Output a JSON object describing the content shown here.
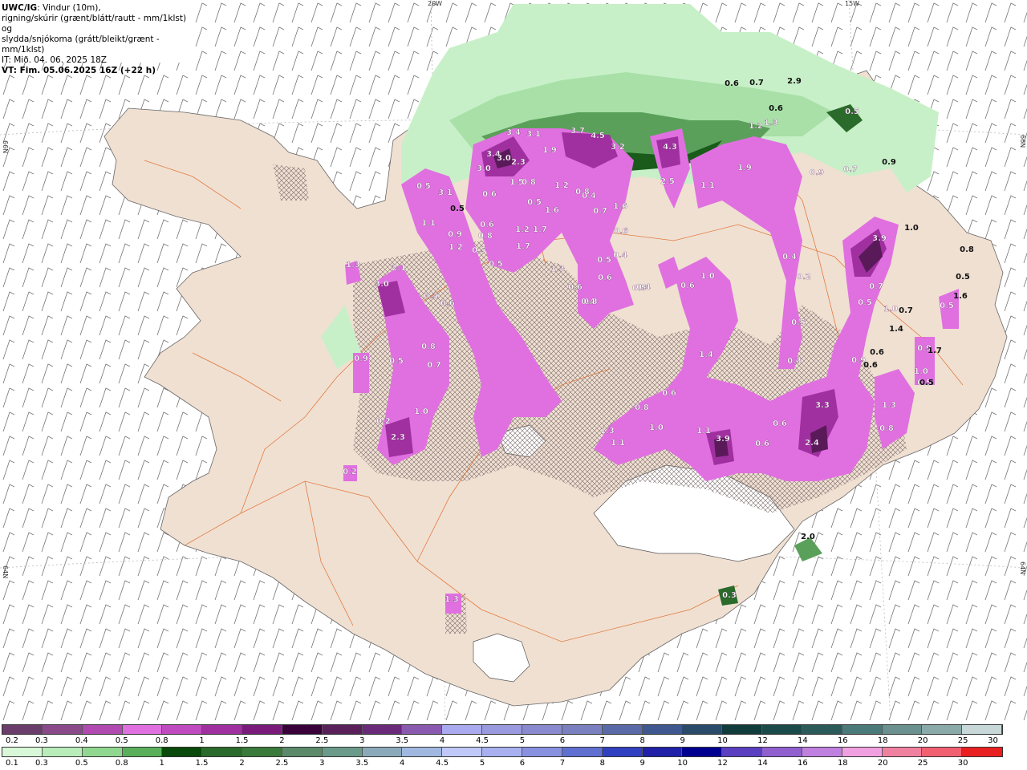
{
  "header": {
    "product": "UWC/IG",
    "line1_rest": ": Vindur (10m),",
    "line2": "rigning/skúrir (grænt/blátt/rautt - mm/1klst) og",
    "line3": "slydda/snjókoma (grátt/bleikt/grænt - mm/1klst)",
    "line4": "IT: Mið. 04. 06. 2025 18Z",
    "line5": "VT: Fim. 05.06.2025 16Z (+22 h)"
  },
  "grid_labels": {
    "lon_20w": "20W",
    "lon_15w": "15W",
    "lat_66n_left": "66N",
    "lat_66n_right": "66N",
    "lat_64n_left": "64N",
    "lat_64n_right": "64N"
  },
  "values": [
    {
      "text": "3.4",
      "c": "light"
    },
    {
      "text": "3.1",
      "c": "light"
    },
    {
      "text": "3.7",
      "c": "light"
    },
    {
      "text": "4.5",
      "c": "light"
    },
    {
      "text": "3.2",
      "c": "light"
    },
    {
      "text": "4.3",
      "c": "light"
    },
    {
      "text": "3.4",
      "c": "light"
    },
    {
      "text": "3.0",
      "c": "light"
    },
    {
      "text": "3.0",
      "c": "light"
    },
    {
      "text": "2.3",
      "c": "light"
    },
    {
      "text": "1.9",
      "c": "light"
    },
    {
      "text": "1.5",
      "c": "light"
    },
    {
      "text": "1.2",
      "c": "light"
    },
    {
      "text": "1.6",
      "c": "light"
    },
    {
      "text": "2.5",
      "c": "light"
    },
    {
      "text": "1.1",
      "c": "light"
    },
    {
      "text": "1.9",
      "c": "light"
    },
    {
      "text": "0.9",
      "c": "light"
    },
    {
      "text": "0.7",
      "c": "light"
    },
    {
      "text": "1.2",
      "c": "light"
    },
    {
      "text": "1.3",
      "c": "light"
    },
    {
      "text": "0.6",
      "c": "dark"
    },
    {
      "text": "0.7",
      "c": "dark"
    },
    {
      "text": "2.9",
      "c": "dark"
    },
    {
      "text": "0.6",
      "c": "dark"
    },
    {
      "text": "0.5",
      "c": "light"
    },
    {
      "text": "0.9",
      "c": "dark"
    },
    {
      "text": "3.9",
      "c": "light"
    },
    {
      "text": "1.0",
      "c": "dark"
    },
    {
      "text": "0.8",
      "c": "dark"
    },
    {
      "text": "0.5",
      "c": "dark"
    },
    {
      "text": "0.7",
      "c": "light"
    },
    {
      "text": "0.5",
      "c": "light"
    },
    {
      "text": "1.0",
      "c": "light"
    },
    {
      "text": "0.7",
      "c": "dark"
    },
    {
      "text": "1.4",
      "c": "dark"
    },
    {
      "text": "0.6",
      "c": "dark"
    },
    {
      "text": "0.9",
      "c": "light"
    },
    {
      "text": "0.6",
      "c": "dark"
    },
    {
      "text": "0.5",
      "c": "light"
    },
    {
      "text": "1.6",
      "c": "dark"
    },
    {
      "text": "0.5",
      "c": "light"
    },
    {
      "text": "0.9",
      "c": "light"
    },
    {
      "text": "1.7",
      "c": "dark"
    },
    {
      "text": "1.0",
      "c": "light"
    },
    {
      "text": "0.5",
      "c": "dark"
    },
    {
      "text": "1.3",
      "c": "light"
    },
    {
      "text": "0.8",
      "c": "light"
    },
    {
      "text": "3.3",
      "c": "light"
    },
    {
      "text": "2.4",
      "c": "light"
    },
    {
      "text": "0.6",
      "c": "light"
    },
    {
      "text": "0.6",
      "c": "light"
    },
    {
      "text": "3.9",
      "c": "light"
    },
    {
      "text": "1.1",
      "c": "light"
    },
    {
      "text": "1.0",
      "c": "light"
    },
    {
      "text": "0.6",
      "c": "light"
    },
    {
      "text": "0.8",
      "c": "light"
    },
    {
      "text": "1.3",
      "c": "light"
    },
    {
      "text": "1.1",
      "c": "light"
    },
    {
      "text": "1.4",
      "c": "light"
    },
    {
      "text": "1.0",
      "c": "light"
    },
    {
      "text": "0.6",
      "c": "light"
    },
    {
      "text": "0.5",
      "c": "light"
    },
    {
      "text": "0.3",
      "c": "light"
    },
    {
      "text": "0.3",
      "c": "light"
    },
    {
      "text": "0.2",
      "c": "light"
    },
    {
      "text": "0.5",
      "c": "light"
    },
    {
      "text": "0.4",
      "c": "light"
    },
    {
      "text": "0.6",
      "c": "light"
    },
    {
      "text": "0.4",
      "c": "light"
    },
    {
      "text": "0.5",
      "c": "light"
    },
    {
      "text": "0.6",
      "c": "light"
    },
    {
      "text": "0.4",
      "c": "light"
    },
    {
      "text": "1.6",
      "c": "light"
    },
    {
      "text": "0.7",
      "c": "light"
    },
    {
      "text": "0.8",
      "c": "light"
    },
    {
      "text": "0.6",
      "c": "light"
    },
    {
      "text": "1.3",
      "c": "light"
    },
    {
      "text": "1.2",
      "c": "light"
    },
    {
      "text": "1.7",
      "c": "light"
    },
    {
      "text": "0.5",
      "c": "light"
    },
    {
      "text": "0.6",
      "c": "light"
    },
    {
      "text": "1.7",
      "c": "light"
    },
    {
      "text": "0.5",
      "c": "light"
    },
    {
      "text": "0.5",
      "c": "light"
    },
    {
      "text": "0.8",
      "c": "light"
    },
    {
      "text": "1.2",
      "c": "light"
    },
    {
      "text": "0.9",
      "c": "light"
    },
    {
      "text": "0.5",
      "c": "light"
    },
    {
      "text": "3.1",
      "c": "light"
    },
    {
      "text": "1.1",
      "c": "light"
    },
    {
      "text": "0.6",
      "c": "light"
    },
    {
      "text": "0.8",
      "c": "light"
    },
    {
      "text": "0.5",
      "c": "dark"
    },
    {
      "text": "1.3",
      "c": "light"
    },
    {
      "text": "2.1",
      "c": "light"
    },
    {
      "text": "3.0",
      "c": "light"
    },
    {
      "text": "0.4",
      "c": "light"
    },
    {
      "text": "0.6",
      "c": "light"
    },
    {
      "text": "0.8",
      "c": "light"
    },
    {
      "text": "0.7",
      "c": "light"
    },
    {
      "text": "0.5",
      "c": "light"
    },
    {
      "text": "0.9",
      "c": "light"
    },
    {
      "text": "1.0",
      "c": "light"
    },
    {
      "text": "2.3",
      "c": "light"
    },
    {
      "text": "0.2",
      "c": "light"
    },
    {
      "text": "0.2",
      "c": "light"
    },
    {
      "text": "1.3",
      "c": "light"
    },
    {
      "text": "2.0",
      "c": "dark"
    },
    {
      "text": "0.3",
      "c": "light"
    },
    {
      "text": "0.4",
      "c": "light"
    },
    {
      "text": "0.4",
      "c": "light"
    }
  ],
  "legend": {
    "row1": {
      "colors": [
        "#6a3d6a",
        "#8a4a8a",
        "#b04ab0",
        "#e070e0",
        "#c04ac0",
        "#a030a0",
        "#7a1a7a",
        "#3a003a",
        "#5a205a",
        "#6a2a7a",
        "#8a5ab0",
        "#aaaaf0",
        "#9a9ae0",
        "#8a8ad0",
        "#7a80c0",
        "#5a6aa8",
        "#405890",
        "#2a4a6a",
        "#103c3c",
        "#1a4a4a",
        "#2a5a5a",
        "#4a7a7a",
        "#6a9090",
        "#8aaaaa",
        "#c8d8d8"
      ],
      "labels": [
        "0.2",
        "0.3",
        "0.4",
        "0.5",
        "0.8",
        "1",
        "1.5",
        "2",
        "2.5",
        "3",
        "3.5",
        "4",
        "4.5",
        "5",
        "6",
        "7",
        "8",
        "9",
        "10",
        "12",
        "14",
        "16",
        "18",
        "20",
        "25",
        "30"
      ]
    },
    "row2": {
      "colors": [
        "#d8f8d8",
        "#b8ecb8",
        "#90d890",
        "#5ab05a",
        "#0a4a0a",
        "#2a6a2a",
        "#3a7a3a",
        "#5a8a6a",
        "#6a9a8a",
        "#8aaaba",
        "#a0b8e0",
        "#c0c8f8",
        "#a8b0f0",
        "#8890e0",
        "#6070d0",
        "#3040c0",
        "#2020a8",
        "#000090",
        "#5a40c0",
        "#9060d0",
        "#c080e0",
        "#f0a0e0",
        "#f080a0",
        "#f06070",
        "#e82020"
      ],
      "labels": [
        "0.1",
        "0.3",
        "0.5",
        "0.8",
        "1",
        "1.5",
        "2",
        "2.5",
        "3",
        "3.5",
        "4",
        "4.5",
        "5",
        "6",
        "7",
        "8",
        "9",
        "10",
        "12",
        "14",
        "16",
        "18",
        "20",
        "25",
        "30"
      ]
    }
  }
}
